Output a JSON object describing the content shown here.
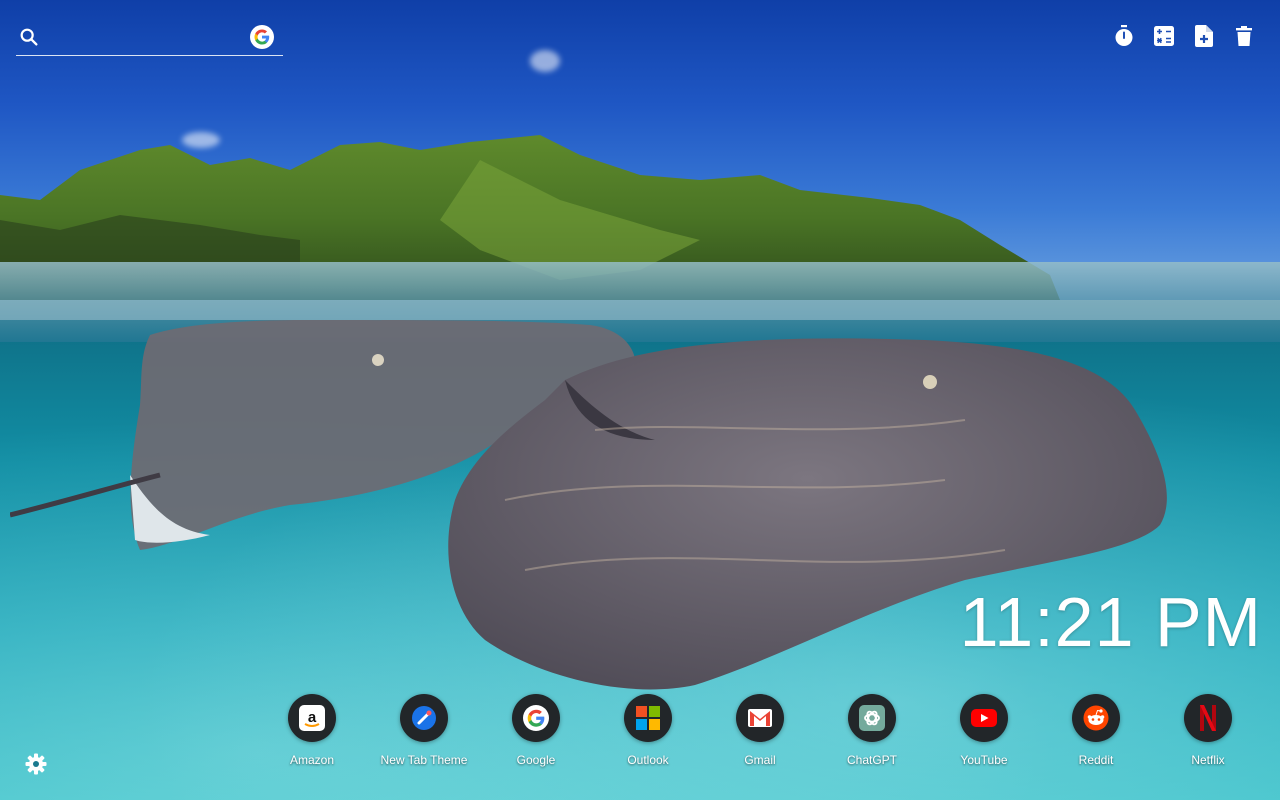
{
  "search": {
    "value": "",
    "placeholder": ""
  },
  "toolbar": {
    "icons": [
      "timer-icon",
      "calculator-icon",
      "note-add-icon",
      "trash-icon"
    ]
  },
  "clock": {
    "time": "11:21 PM"
  },
  "shortcuts": [
    {
      "label": "Amazon",
      "icon": "amazon-icon"
    },
    {
      "label": "New Tab Theme",
      "icon": "new-tab-theme-icon"
    },
    {
      "label": "Google",
      "icon": "google-icon"
    },
    {
      "label": "Outlook",
      "icon": "outlook-icon"
    },
    {
      "label": "Gmail",
      "icon": "gmail-icon"
    },
    {
      "label": "ChatGPT",
      "icon": "chatgpt-icon"
    },
    {
      "label": "YouTube",
      "icon": "youtube-icon"
    },
    {
      "label": "Reddit",
      "icon": "reddit-icon"
    },
    {
      "label": "Netflix",
      "icon": "netflix-icon"
    }
  ],
  "colors": {
    "shortcut_bg": "#222629",
    "youtube_red": "#FF0000",
    "reddit_orange": "#FF4500",
    "netflix_red": "#E50914"
  }
}
